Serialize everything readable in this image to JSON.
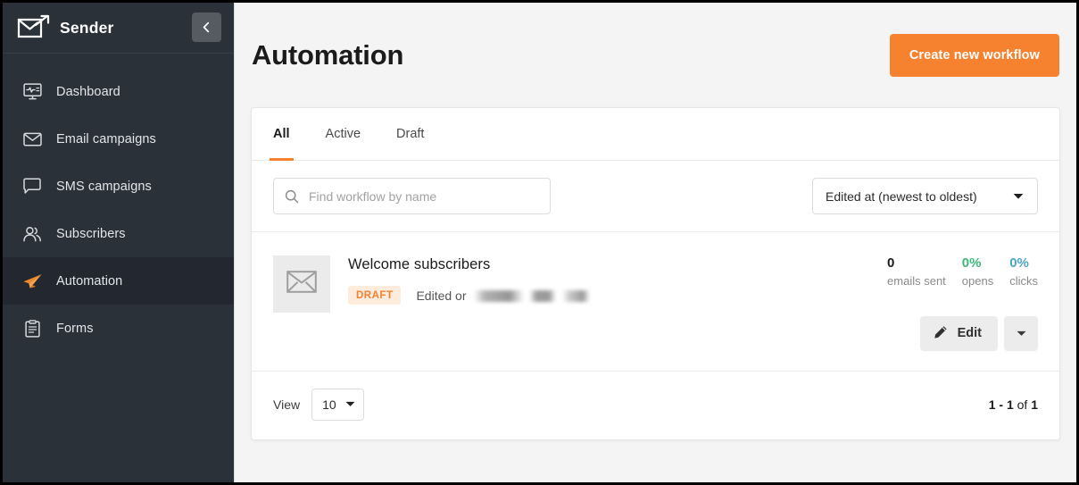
{
  "brand": {
    "name": "Sender",
    "logo_icon": "envelope-arrow-logo",
    "collapse_icon": "chevron-left-icon"
  },
  "sidebar": {
    "items": [
      {
        "label": "Dashboard",
        "icon": "monitor-icon",
        "active": false
      },
      {
        "label": "Email campaigns",
        "icon": "envelope-icon",
        "active": false
      },
      {
        "label": "SMS campaigns",
        "icon": "chat-bubble-icon",
        "active": false
      },
      {
        "label": "Subscribers",
        "icon": "people-icon",
        "active": false
      },
      {
        "label": "Automation",
        "icon": "paper-plane-icon",
        "active": true
      },
      {
        "label": "Forms",
        "icon": "clipboard-icon",
        "active": false
      }
    ]
  },
  "header": {
    "title": "Automation",
    "create_button": "Create new workflow",
    "accent_color": "#f6812f"
  },
  "tabs": [
    {
      "label": "All",
      "active": true
    },
    {
      "label": "Active",
      "active": false
    },
    {
      "label": "Draft",
      "active": false
    }
  ],
  "search": {
    "placeholder": "Find workflow by name",
    "value": "",
    "icon": "search-icon"
  },
  "sort": {
    "selected": "Edited at (newest to oldest)",
    "icon": "chevron-down-icon"
  },
  "workflow": {
    "thumbnail_icon": "envelope-icon",
    "name": "Welcome subscribers",
    "status_badge": "DRAFT",
    "badge_bg": "#fdebdc",
    "badge_color": "#f08232",
    "edited_text": "Edited or",
    "edited_value_redacted": true,
    "stats": [
      {
        "value": "0",
        "label": "emails sent",
        "color": "#1b1b1b"
      },
      {
        "value": "0%",
        "label": "opens",
        "color": "#3cb878"
      },
      {
        "value": "0%",
        "label": "clicks",
        "color": "#49a7c4"
      }
    ],
    "edit_button": "Edit",
    "edit_icon": "pencil-icon",
    "more_icon": "chevron-down-icon"
  },
  "footer": {
    "view_label": "View",
    "page_size": "10",
    "page_size_icon": "chevron-down-icon",
    "range_start": "1 - 1",
    "range_sep": " of ",
    "range_total": "1"
  }
}
